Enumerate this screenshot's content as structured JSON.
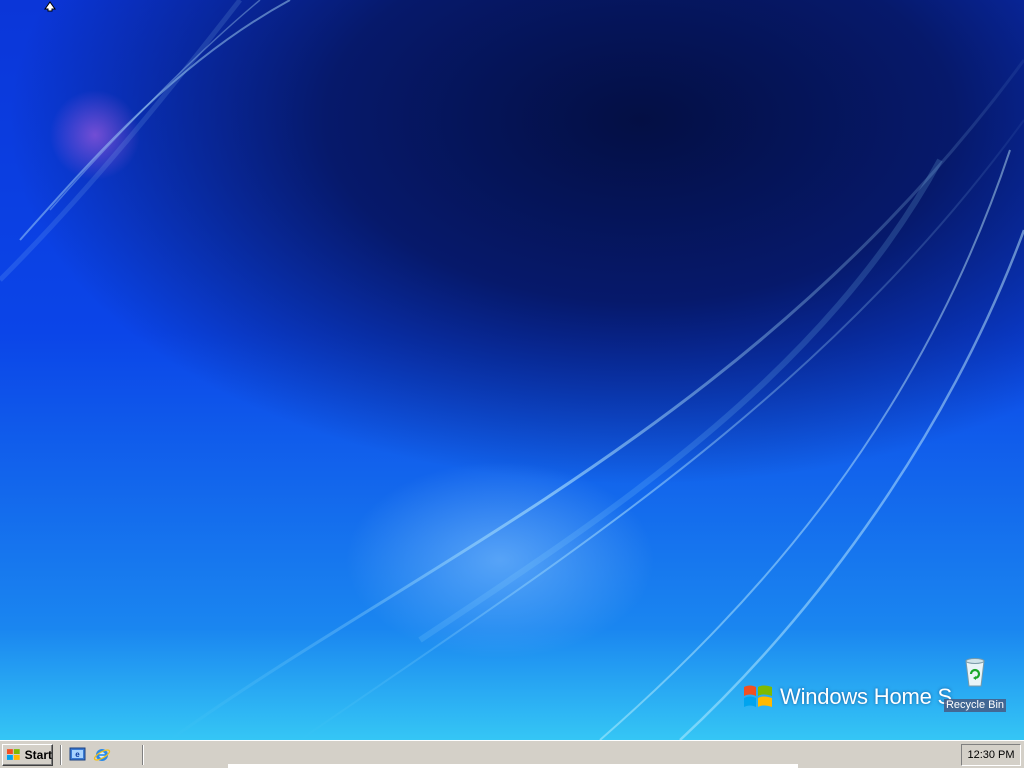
{
  "desktop": {
    "branding": "Windows Home S",
    "icons": [
      {
        "label": "Recycle Bin",
        "icon": "recycle-bin-icon"
      }
    ]
  },
  "taskbar": {
    "start_label": "Start",
    "quick_launch": [
      {
        "icon": "show-desktop-icon"
      },
      {
        "icon": "internet-explorer-icon"
      }
    ],
    "clock": "12:30 PM"
  },
  "colors": {
    "taskbar_bg": "#d4d0c8",
    "desktop_dark": "#040f44",
    "desktop_light": "#35c6f5"
  }
}
